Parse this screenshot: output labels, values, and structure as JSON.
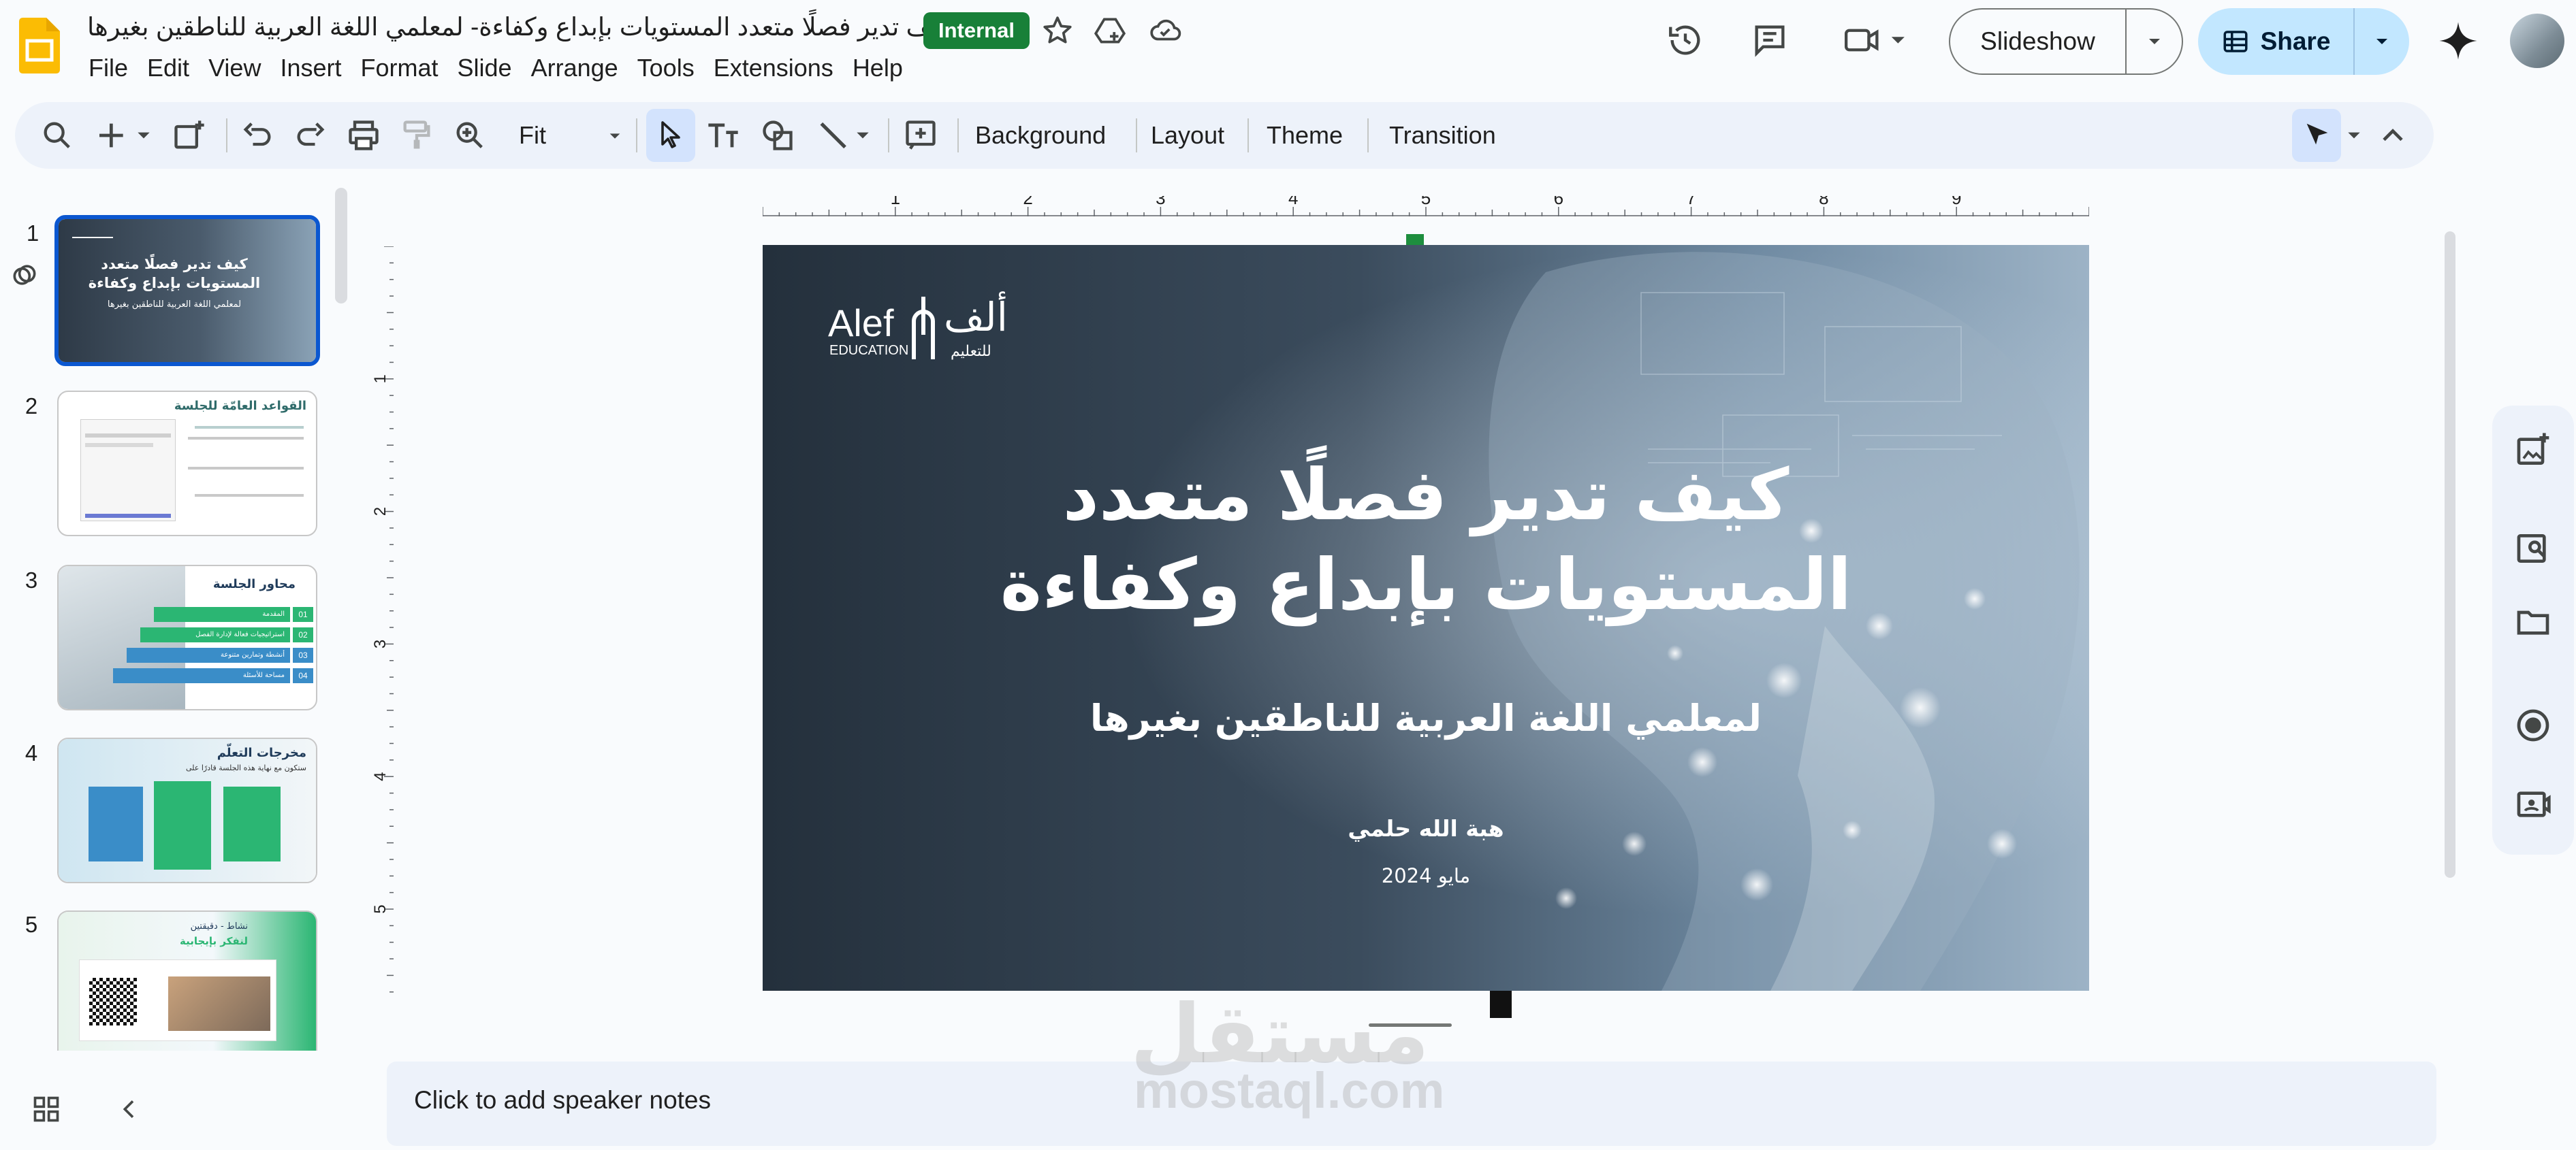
{
  "header": {
    "title": "كيف تدير فصلًا متعدد المستويات بإبداع وكفاءة- لمعلمي اللغة العربية للناطقين بغيرها",
    "badge": "Internal",
    "menu": [
      "File",
      "Edit",
      "View",
      "Insert",
      "Format",
      "Slide",
      "Arrange",
      "Tools",
      "Extensions",
      "Help"
    ],
    "slideshow_label": "Slideshow",
    "share_label": "Share"
  },
  "toolbar": {
    "zoom": "Fit",
    "background_label": "Background",
    "layout_label": "Layout",
    "theme_label": "Theme",
    "transition_label": "Transition"
  },
  "ruler": {
    "h_marks": [
      "1",
      "2",
      "3",
      "4",
      "5",
      "6",
      "7",
      "8",
      "9"
    ],
    "v_marks": [
      "1",
      "2",
      "3",
      "4",
      "5"
    ]
  },
  "filmstrip": [
    {
      "num": "1",
      "title": "كيف تدير فصلًا متعدد المستويات بإبداع وكفاءة",
      "subtitle": "لمعلمي اللغة العربية للناطقين بغيرها",
      "selected": true
    },
    {
      "num": "2",
      "title": "القواعد العامّة للجلسة"
    },
    {
      "num": "3",
      "title": "محاور الجلسة",
      "items": [
        "المقدمة",
        "استراتيجيات فعالة لإدارة الفصل",
        "أنشطة وتمارين متنوعة",
        "مساحة للأسئلة"
      ],
      "item_nums": [
        "01",
        "02",
        "03",
        "04"
      ]
    },
    {
      "num": "4",
      "title": "مخرجات التعلّم",
      "subtitle": "ستكون مع نهاية هذه الجلسة قادرًا على"
    },
    {
      "num": "5",
      "title": "نشاط - دقيقتين",
      "subtitle": "لنفكر بإيجابية"
    }
  ],
  "slide": {
    "logo_text": "Alef",
    "logo_sub": "EDUCATION",
    "logo_ar": "ألف",
    "logo_ar_sub": "للتعليم",
    "title_line1": "كيف تدير فصلًا متعدد",
    "title_line2": "المستويات بإبداع وكفاءة",
    "subtitle": "لمعلمي اللغة العربية للناطقين بغيرها",
    "author": "هبة الله حلمي",
    "date": "مايو 2024"
  },
  "notes": {
    "placeholder": "Click to add speaker notes"
  },
  "watermark": {
    "ar": "مستقل",
    "en": "mostaql.com"
  },
  "colors": {
    "accent": "#0b57d0",
    "badge": "#188038",
    "share": "#c2e7ff",
    "toolbar": "#edf2fa",
    "thumb_green": "#2bb673",
    "thumb_blue": "#3a8dc8"
  }
}
